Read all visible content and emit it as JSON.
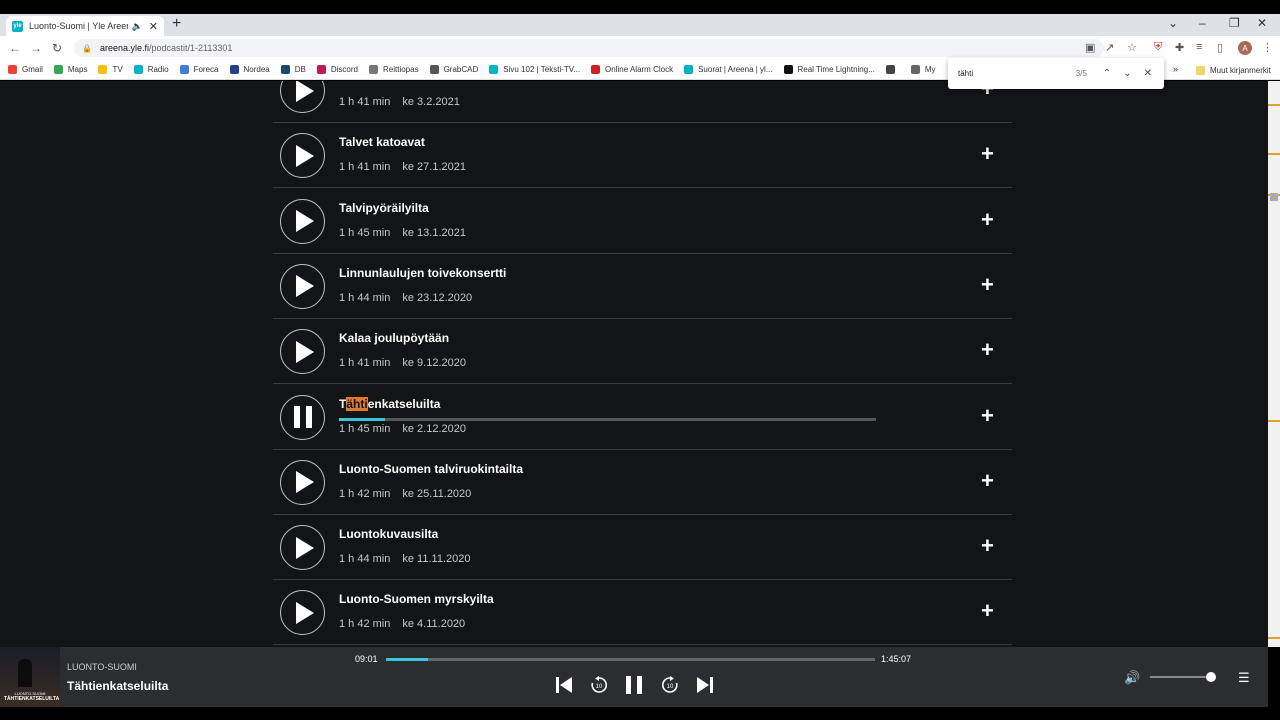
{
  "browser": {
    "tab_title": "Luonto-Suomi | Yle Areena -",
    "tab_favicon": "yle",
    "url_host": "areena.yle.fi",
    "url_path": "/podcastit/1-2113301",
    "profile_initial": "A",
    "bookmarks": [
      {
        "label": "Gmail",
        "color": "#ea4335"
      },
      {
        "label": "Maps",
        "color": "#34a853"
      },
      {
        "label": "TV",
        "color": "#f4c20d"
      },
      {
        "label": "Radio",
        "color": "#00b4c8"
      },
      {
        "label": "Foreca",
        "color": "#3b7dd8"
      },
      {
        "label": "Nordea",
        "color": "#2a3c8c"
      },
      {
        "label": "DB",
        "color": "#1a4a6a"
      },
      {
        "label": "Discord",
        "color": "#c2185b"
      },
      {
        "label": "Reittiopas",
        "color": "#777777"
      },
      {
        "label": "GrabCAD",
        "color": "#555555"
      },
      {
        "label": "Sivu 102 | Teksti-TV...",
        "color": "#00b4c8"
      },
      {
        "label": "Online Alarm Clock",
        "color": "#cc2222"
      },
      {
        "label": "Suorat | Areena | yl...",
        "color": "#00b4c8"
      },
      {
        "label": "Real Time Lightning...",
        "color": "#111111"
      },
      {
        "label": "",
        "color": "#444444"
      },
      {
        "label": "My",
        "color": "#666666"
      }
    ],
    "more_bookmarks": "Muut kirjanmerkit"
  },
  "find": {
    "query": "tähti",
    "count": "3/5"
  },
  "episodes": [
    {
      "title": "",
      "duration": "1 h 41 min",
      "date": "ke 3.2.2021",
      "state": "play"
    },
    {
      "title": "Talvet katoavat",
      "duration": "1 h 41 min",
      "date": "ke 27.1.2021",
      "state": "play"
    },
    {
      "title": "Talvipyöräilyilta",
      "duration": "1 h 45 min",
      "date": "ke 13.1.2021",
      "state": "play"
    },
    {
      "title": "Linnunlaulujen toivekonsertti",
      "duration": "1 h 44 min",
      "date": "ke 23.12.2020",
      "state": "play"
    },
    {
      "title": "Kalaa joulupöytään",
      "duration": "1 h 41 min",
      "date": "ke 9.12.2020",
      "state": "play"
    },
    {
      "title_pre": "T",
      "title_hl": "ähti",
      "title_post": "enkatseluilta",
      "duration": "1 h 45 min",
      "date": "ke 2.12.2020",
      "state": "pause",
      "progress": 0.085
    },
    {
      "title": "Luonto-Suomen talviruokintailta",
      "duration": "1 h 42 min",
      "date": "ke 25.11.2020",
      "state": "play"
    },
    {
      "title": "Luontokuvausilta",
      "duration": "1 h 44 min",
      "date": "ke 11.11.2020",
      "state": "play"
    },
    {
      "title": "Luonto-Suomen myrskyilta",
      "duration": "1 h 42 min",
      "date": "ke 4.11.2020",
      "state": "play"
    }
  ],
  "player": {
    "art_label": "TÄHTIENKATSELUILTA",
    "art_sublabel": "LUONTO-SUOMI",
    "series": "LUONTO-SUOMI",
    "title": "Tähtienkatseluilta",
    "current_time": "09:01",
    "total_time": "1:45:07",
    "progress": 0.086,
    "volume": 0.9,
    "accent": "#39c6d8"
  }
}
